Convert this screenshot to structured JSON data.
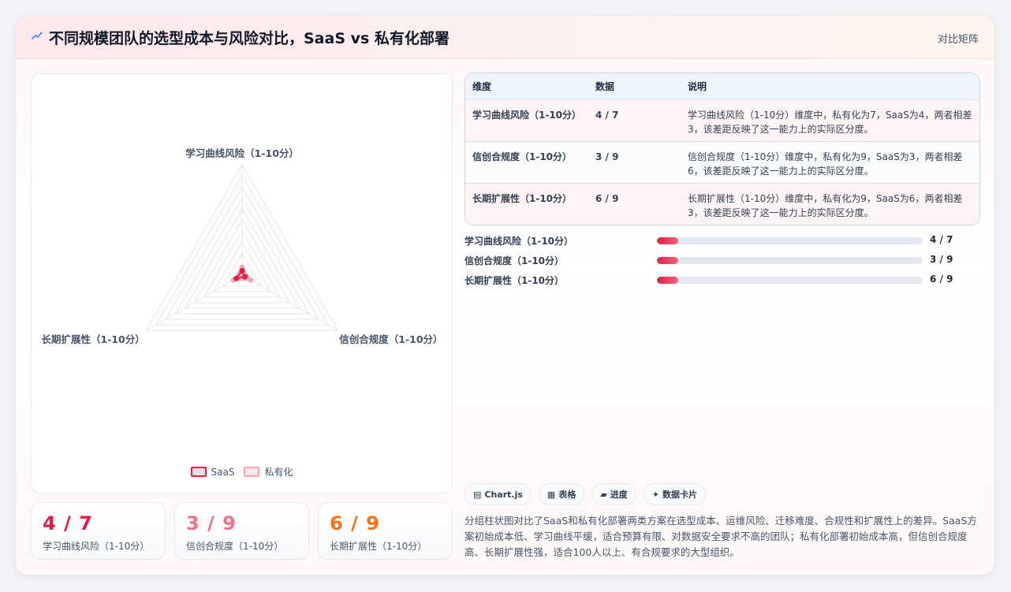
{
  "header": {
    "title": "不同规模团队的选型成本与风险对比，SaaS vs 私有化部署",
    "link": "对比矩阵",
    "icon": "trend-icon"
  },
  "colors": {
    "saas": "#e11d48",
    "private": "#f4a5b3",
    "accent_1": "#e11d48",
    "accent_2": "#f17085",
    "accent_3": "#f97316"
  },
  "chart_data": {
    "type": "radar",
    "categories": [
      "学习曲线风险（1-10分）",
      "信创合规度（1-10分）",
      "长期扩展性（1-10分）"
    ],
    "series": [
      {
        "name": "SaaS",
        "values": [
          4,
          3,
          6
        ]
      },
      {
        "name": "私有化",
        "values": [
          7,
          9,
          9
        ]
      }
    ],
    "rlim": [
      0,
      100
    ],
    "grid": true,
    "legend": "bottom"
  },
  "legend": {
    "saas": "SaaS",
    "private": "私有化"
  },
  "stats": [
    {
      "value": "4 / 7",
      "label": "学习曲线风险（1-10分）"
    },
    {
      "value": "3 / 9",
      "label": "信创合规度（1-10分）"
    },
    {
      "value": "6 / 9",
      "label": "长期扩展性（1-10分）"
    }
  ],
  "table": {
    "headers": [
      "维度",
      "数据",
      "说明"
    ],
    "rows": [
      {
        "dim": "学习曲线风险（1-10分）",
        "data": "4 / 7",
        "desc": "学习曲线风险（1-10分）维度中，私有化为7，SaaS为4，两者相差3，该差距反映了这一能力上的实际区分度。"
      },
      {
        "dim": "信创合规度（1-10分）",
        "data": "3 / 9",
        "desc": "信创合规度（1-10分）维度中，私有化为9，SaaS为3，两者相差6，该差距反映了这一能力上的实际区分度。"
      },
      {
        "dim": "长期扩展性（1-10分）",
        "data": "6 / 9",
        "desc": "长期扩展性（1-10分）维度中，私有化为9，SaaS为6，两者相差3，该差距反映了这一能力上的实际区分度。"
      }
    ]
  },
  "progress": [
    {
      "label": "学习曲线风险（1-10分）",
      "value": "4 / 7",
      "fill_percent": 8
    },
    {
      "label": "信创合规度（1-10分）",
      "value": "3 / 9",
      "fill_percent": 8
    },
    {
      "label": "长期扩展性（1-10分）",
      "value": "6 / 9",
      "fill_percent": 8
    }
  ],
  "chips": [
    {
      "icon": "▤",
      "label": "Chart.js"
    },
    {
      "icon": "▦",
      "label": "表格"
    },
    {
      "icon": "▰",
      "label": "进度"
    },
    {
      "icon": "✦",
      "label": "数据卡片"
    }
  ],
  "description": "分组柱状图对比了SaaS和私有化部署两类方案在选型成本、运维风险、迁移难度、合规性和扩展性上的差异。SaaS方案初始成本低、学习曲线平缓，适合预算有限、对数据安全要求不高的团队；私有化部署初始成本高，但信创合规度高、长期扩展性强，适合100人以上、有合规要求的大型组织。"
}
